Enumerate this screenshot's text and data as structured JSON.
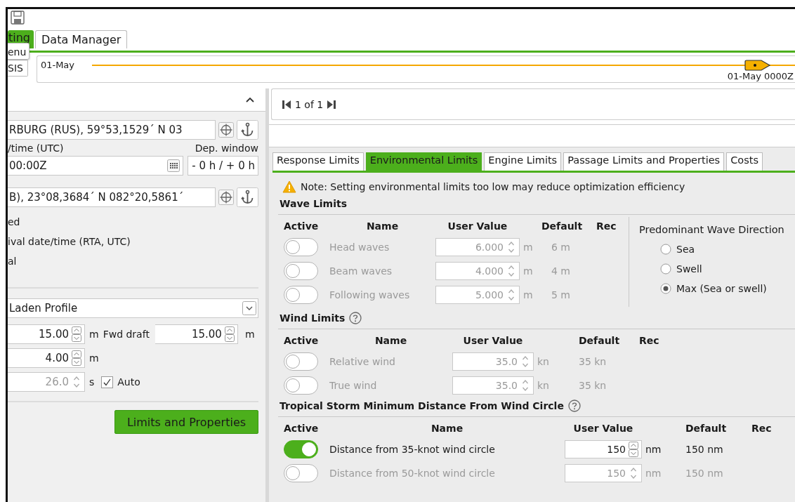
{
  "main_tabs": [
    {
      "label": "ting",
      "selected": true
    },
    {
      "label": "Data Manager",
      "selected": false
    }
  ],
  "menu_popup": "enu",
  "side_button": "SIS",
  "timeline": {
    "start": "01-May",
    "marker": "01-May 0000Z"
  },
  "route": {
    "departure": "RBURG (RUS), 59°53,1529´ N 03",
    "date_label": "/time (UTC)",
    "window_label": "Dep. window",
    "date_value": "00:00Z",
    "window_value": "- 0 h / + 0 h",
    "destination": "B), 23°08,3684´ N 082°20,5861´",
    "options": [
      "ed",
      "ival date/time (RTA, UTC)",
      "al"
    ],
    "profile": "Laden Profile",
    "spin_rows": [
      {
        "value": "15.00",
        "unit": "m",
        "disabled": false,
        "extra_label": "Fwd draft",
        "extra_value": "15.00",
        "extra_unit": "m"
      },
      {
        "value": "4.00",
        "unit": "m",
        "disabled": false
      },
      {
        "value": "26.0",
        "unit": "s",
        "disabled": true,
        "check": {
          "label": "Auto",
          "checked": true
        }
      }
    ],
    "button": "Limits and Properties"
  },
  "pager": "1 of 1",
  "tabs": [
    {
      "label": "Response Limits",
      "selected": false
    },
    {
      "label": "Environmental Limits",
      "selected": true
    },
    {
      "label": "Engine Limits",
      "selected": false
    },
    {
      "label": "Passage Limits and Properties",
      "selected": false
    },
    {
      "label": "Costs",
      "selected": false
    }
  ],
  "note": "Note: Setting environmental limits too low may reduce optimization efficiency",
  "wave_limits": {
    "title": "Wave Limits",
    "columns": [
      "Active",
      "Name",
      "User Value",
      "Default",
      "Rec"
    ],
    "rows": [
      {
        "active": false,
        "name": "Head waves",
        "value": "6.000",
        "unit": "m",
        "default": "6 m"
      },
      {
        "active": false,
        "name": "Beam waves",
        "value": "4.000",
        "unit": "m",
        "default": "4 m"
      },
      {
        "active": false,
        "name": "Following waves",
        "value": "5.000",
        "unit": "m",
        "default": "5 m"
      }
    ]
  },
  "wave_direction": {
    "title": "Predominant Wave Direction",
    "options": [
      {
        "label": "Sea",
        "selected": false
      },
      {
        "label": "Swell",
        "selected": false
      },
      {
        "label": "Max (Sea or swell)",
        "selected": true
      }
    ]
  },
  "wind_limits": {
    "title": "Wind Limits",
    "columns": [
      "Active",
      "Name",
      "User Value",
      "Default",
      "Rec"
    ],
    "rows": [
      {
        "active": false,
        "name": "Relative wind",
        "value": "35.0",
        "unit": "kn",
        "default": "35 kn"
      },
      {
        "active": false,
        "name": "True wind",
        "value": "35.0",
        "unit": "kn",
        "default": "35 kn"
      }
    ]
  },
  "tropical_storm": {
    "title": "Tropical Storm Minimum Distance From Wind Circle",
    "columns": [
      "Active",
      "Name",
      "User Value",
      "Default",
      "Rec"
    ],
    "rows": [
      {
        "active": true,
        "name": "Distance from 35-knot wind circle",
        "value": "150",
        "unit": "nm",
        "default": "150 nm"
      },
      {
        "active": false,
        "name": "Distance from 50-knot wind circle",
        "value": "150",
        "unit": "nm",
        "default": "150 nm"
      }
    ]
  }
}
